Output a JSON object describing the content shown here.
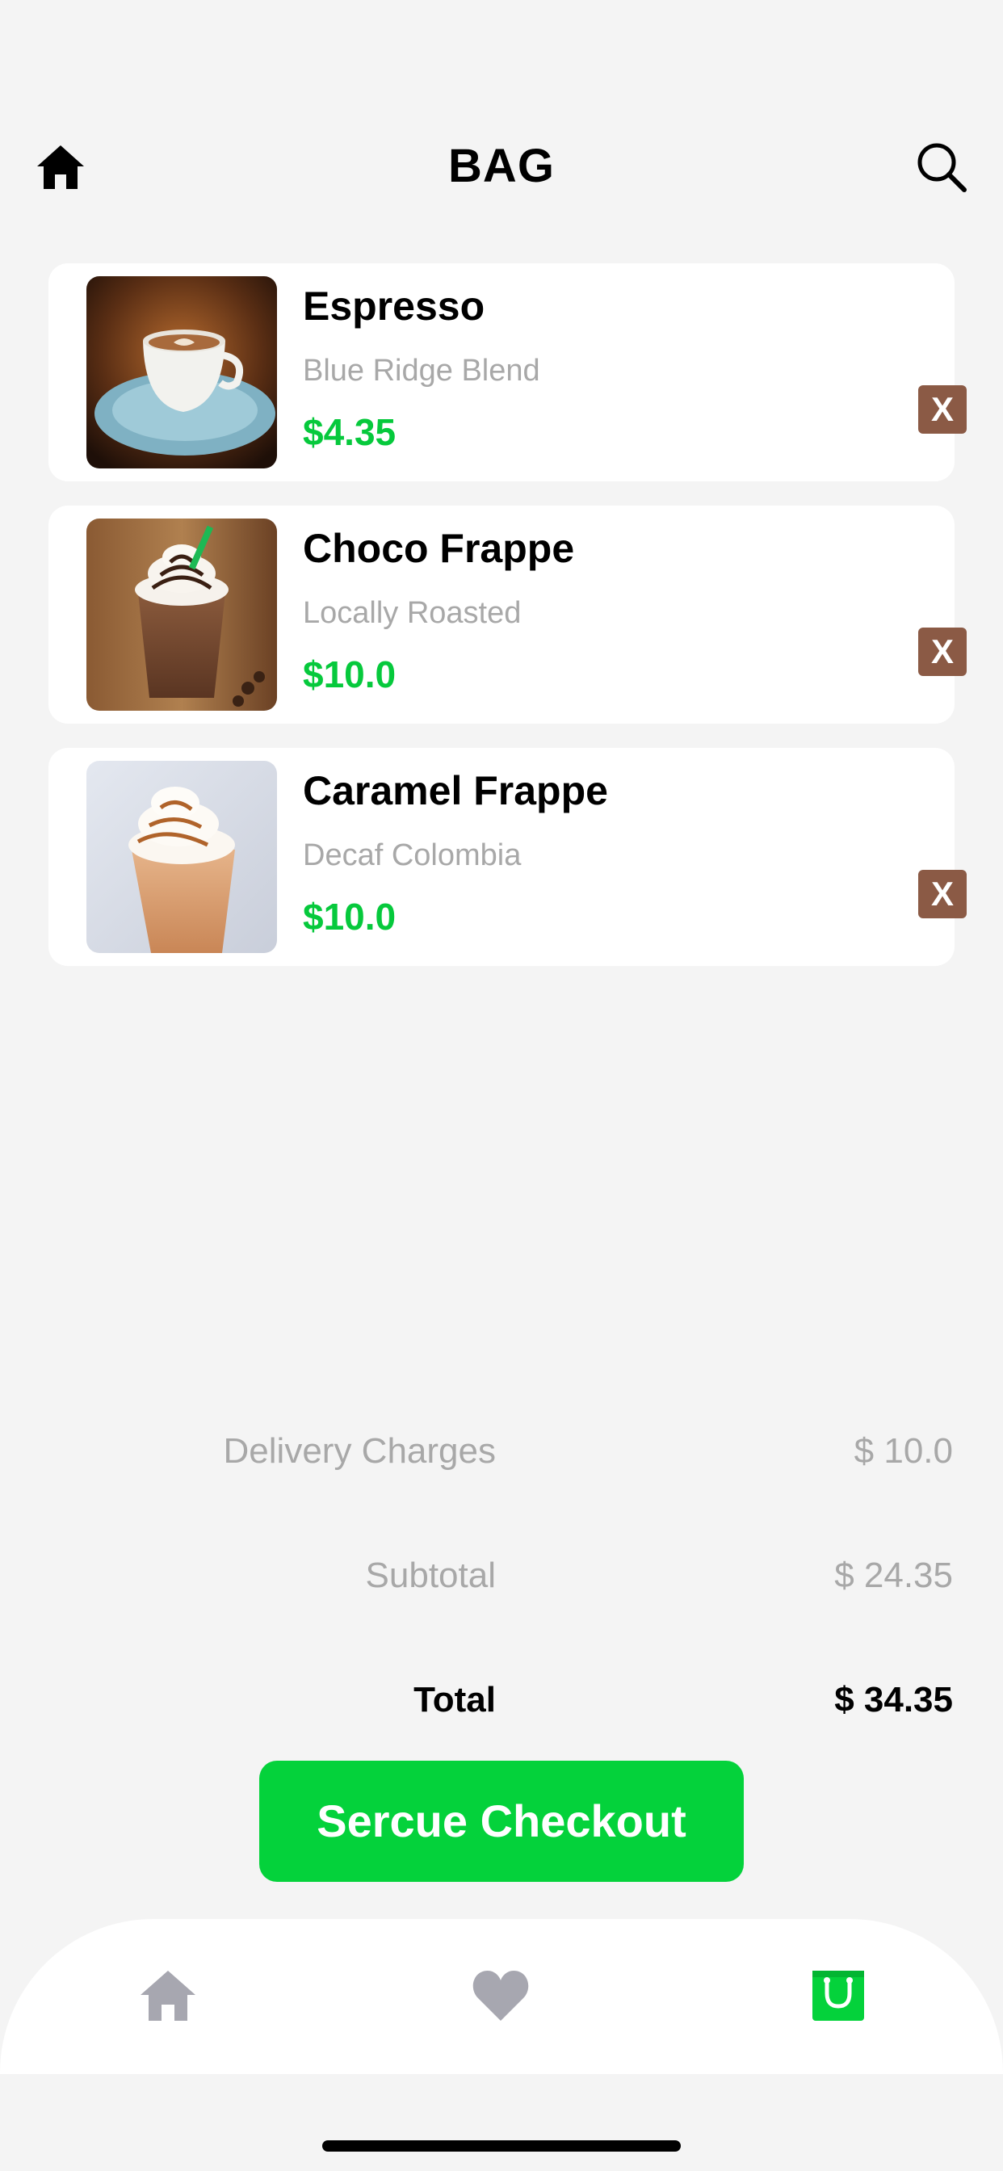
{
  "header": {
    "title": "BAG",
    "left_icon": "home-icon",
    "right_icon": "search-icon"
  },
  "cart": {
    "items": [
      {
        "name": "Espresso",
        "description": "Blue Ridge Blend",
        "price": "$4.35",
        "remove_label": "X",
        "image": "espresso-cup-image"
      },
      {
        "name": "Choco Frappe",
        "description": "Locally Roasted",
        "price": "$10.0",
        "remove_label": "X",
        "image": "choco-frappe-image"
      },
      {
        "name": "Caramel Frappe",
        "description": "Decaf Colombia",
        "price": "$10.0",
        "remove_label": "X",
        "image": "caramel-frappe-image"
      }
    ]
  },
  "summary": {
    "delivery_label": "Delivery Charges",
    "delivery_value": "$ 10.0",
    "subtotal_label": "Subtotal",
    "subtotal_value": "$ 24.35",
    "total_label": "Total",
    "total_value": "$ 34.35"
  },
  "checkout": {
    "label": "Sercue Checkout"
  },
  "bottom_nav": {
    "items": [
      {
        "icon": "home-icon",
        "active": false
      },
      {
        "icon": "heart-icon",
        "active": false
      },
      {
        "icon": "shopping-bag-icon",
        "active": true
      }
    ]
  },
  "colors": {
    "accent": "#04d23b",
    "price": "#06c93c",
    "remove": "#8b5a45",
    "muted_text": "#a8a8a8",
    "inactive_icon": "#a7a7b0",
    "background": "#f4f4f4"
  }
}
